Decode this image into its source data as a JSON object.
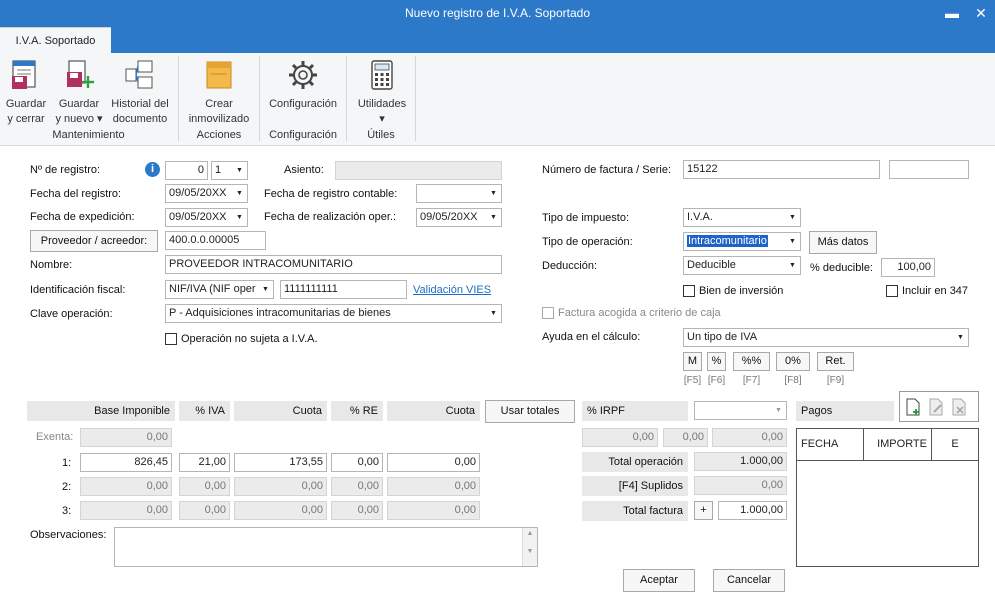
{
  "window": {
    "title": "Nuevo registro de I.V.A. Soportado",
    "minimize": "▬",
    "close": "✕"
  },
  "tab": {
    "label": "I.V.A. Soportado"
  },
  "ribbon": {
    "save_close": [
      "Guardar",
      "y cerrar"
    ],
    "save_new": [
      "Guardar",
      "y nuevo ▾"
    ],
    "history": [
      "Historial del",
      "documento"
    ],
    "group_maint": "Mantenimiento",
    "create_asset": [
      "Crear",
      "inmovilizado"
    ],
    "group_actions": "Acciones",
    "config": "Configuración",
    "group_config": "Configuración",
    "utilities": "Utilidades",
    "utilities_arrow": "▾",
    "group_utils": "Útiles"
  },
  "form": {
    "reg_num_label": "Nº de registro:",
    "reg_num": "0",
    "reg_series": "1",
    "asiento_label": "Asiento:",
    "fecha_registro_label": "Fecha del registro:",
    "fecha_registro": "09/05/20XX",
    "fecha_contable_label": "Fecha de registro contable:",
    "fecha_expedicion_label": "Fecha de expedición:",
    "fecha_expedicion": "09/05/20XX",
    "fecha_realizacion_label": "Fecha de realización oper.:",
    "fecha_realizacion": "09/05/20XX",
    "proveedor_button": "Proveedor / acreedor:",
    "proveedor_code": "400.0.0.00005",
    "nombre_label": "Nombre:",
    "nombre": "PROVEEDOR INTRACOMUNITARIO",
    "ident_label": "Identificación fiscal:",
    "ident_type": "NIF/IVA (NIF oper",
    "ident_value": "1111111111",
    "vies_link": "Validación VIES",
    "clave_label": "Clave operación:",
    "clave": "P - Adquisiciones intracomunitarias de bienes",
    "no_sujeta": "Operación no sujeta a I.V.A.",
    "factura_label": "Número de factura / Serie:",
    "factura": "15122",
    "tipo_impuesto_label": "Tipo de impuesto:",
    "tipo_impuesto": "I.V.A.",
    "tipo_operacion_label": "Tipo de operación:",
    "tipo_operacion": "Intracomunitario",
    "mas_datos": "Más datos",
    "deduccion_label": "Deducción:",
    "deduccion": "Deducible",
    "pct_deducible_label": "% deducible:",
    "pct_deducible": "100,00",
    "bien_inversion": "Bien de inversión",
    "incluir_347": "Incluir en 347",
    "criterio_caja": "Factura acogida a criterio de caja",
    "ayuda_label": "Ayuda en el cálculo:",
    "ayuda": "Un tipo de IVA",
    "calc_buttons": [
      {
        "label": "M",
        "key": "[F5]"
      },
      {
        "label": "%",
        "key": "[F6]"
      },
      {
        "label": "%%",
        "key": "[F7]"
      },
      {
        "label": "0%",
        "key": "[F8]"
      },
      {
        "label": "Ret.",
        "key": "[F9]"
      }
    ]
  },
  "table": {
    "headers": [
      "Base Imponible",
      "% IVA",
      "Cuota",
      "% RE",
      "Cuota"
    ],
    "usar_totales": "Usar totales",
    "irpf_label": "% IRPF",
    "exenta_label": "Exenta:",
    "exenta": "0,00",
    "rows": [
      {
        "label": "1:",
        "base": "826,45",
        "iva": "21,00",
        "cuota": "173,55",
        "re": "0,00",
        "cuota_re": "0,00"
      },
      {
        "label": "2:",
        "base": "0,00",
        "iva": "0,00",
        "cuota": "0,00",
        "re": "0,00",
        "cuota_re": "0,00"
      },
      {
        "label": "3:",
        "base": "0,00",
        "iva": "0,00",
        "cuota": "0,00",
        "re": "0,00",
        "cuota_re": "0,00"
      }
    ],
    "irpf_values": [
      "0,00",
      "0,00",
      "0,00"
    ],
    "total_operacion_label": "Total operación",
    "total_operacion": "1.000,00",
    "suplidos_label": "[F4] Suplidos",
    "suplidos": "0,00",
    "total_factura_label": "Total factura",
    "plus": "+",
    "total_factura": "1.000,00"
  },
  "pagos": {
    "label": "Pagos",
    "cols": [
      "FECHA",
      "IMPORTE",
      "E"
    ]
  },
  "observaciones_label": "Observaciones:",
  "buttons": {
    "aceptar": "Aceptar",
    "cancelar": "Cancelar"
  }
}
